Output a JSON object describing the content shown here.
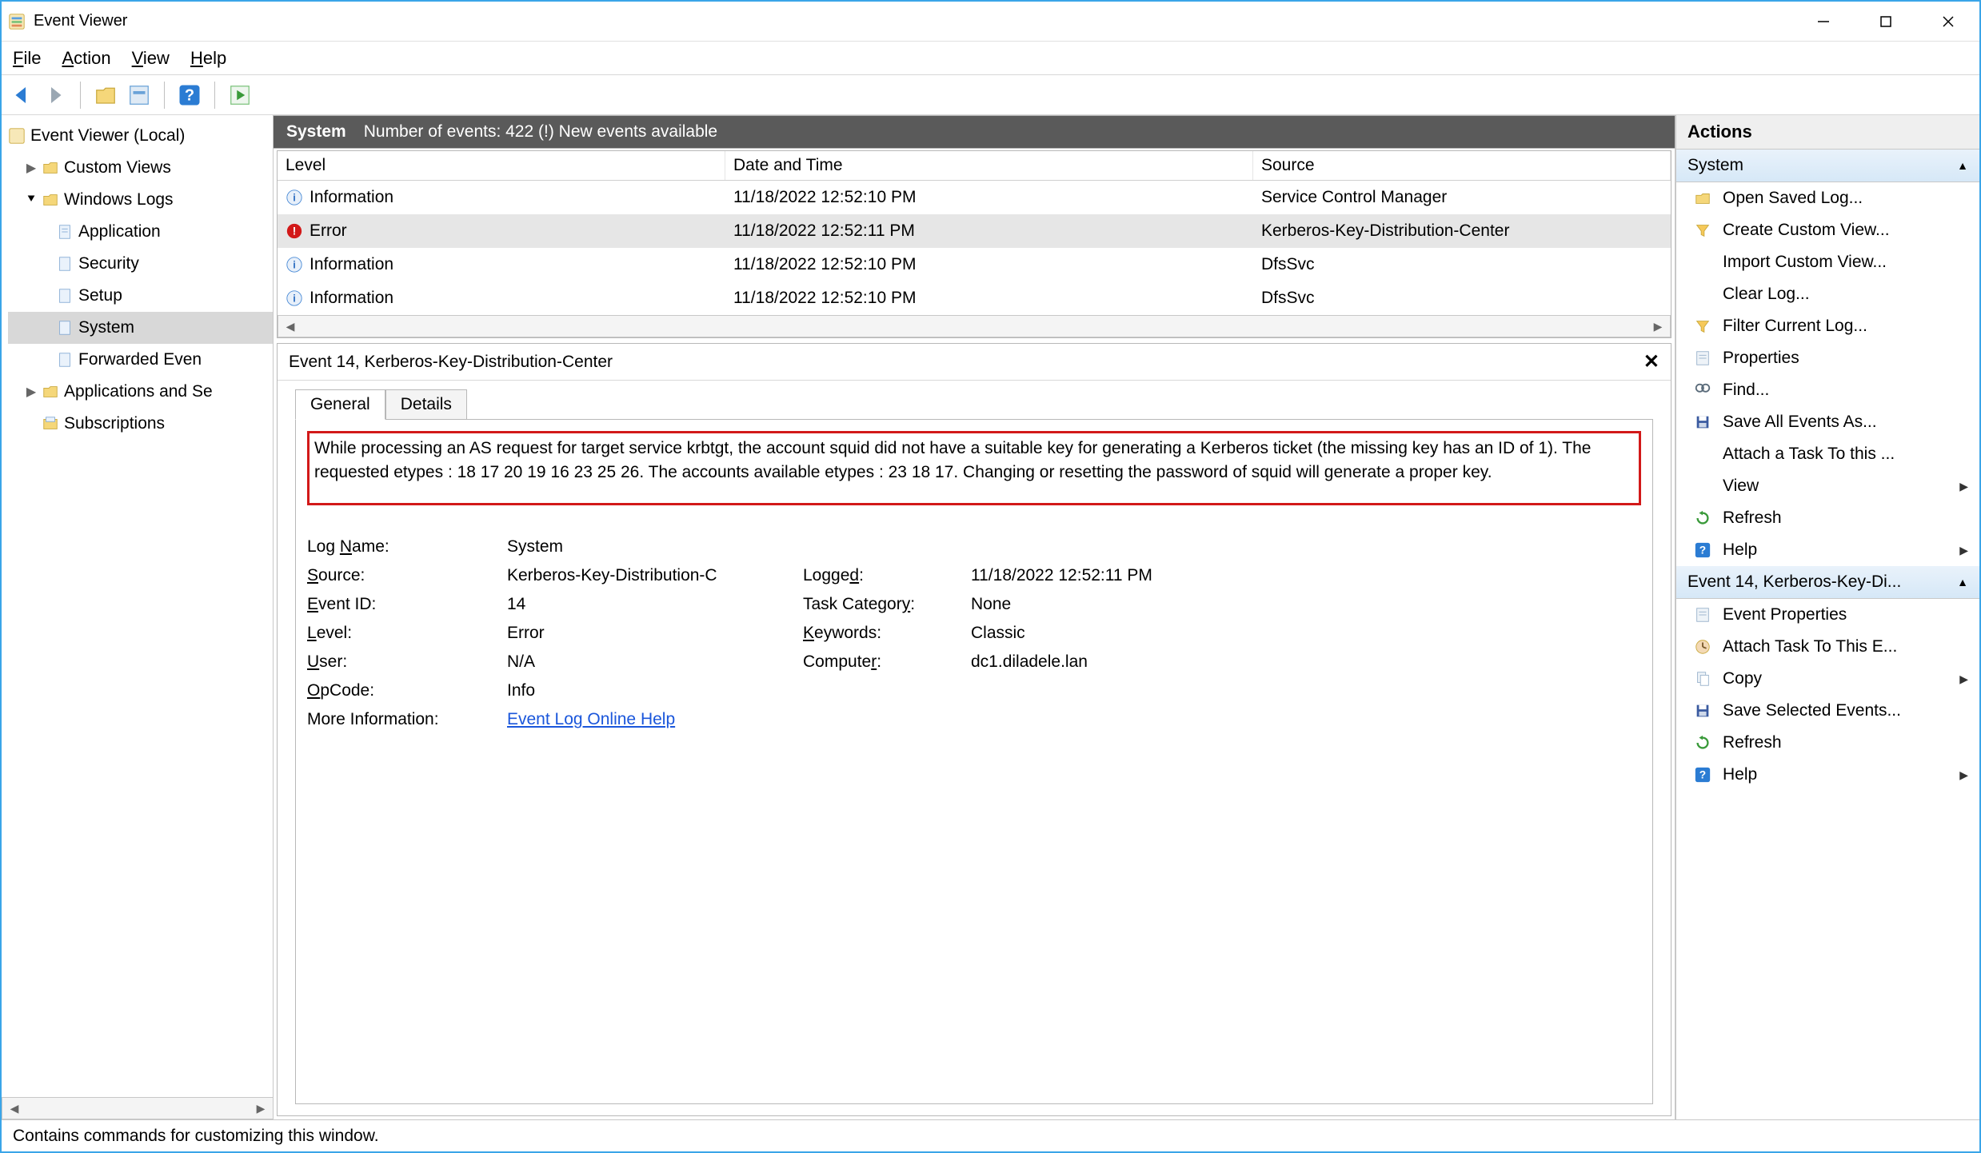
{
  "window": {
    "title": "Event Viewer"
  },
  "menu": {
    "file": "File",
    "action": "Action",
    "view": "View",
    "help": "Help"
  },
  "tree": {
    "root": "Event Viewer (Local)",
    "custom_views": "Custom Views",
    "windows_logs": "Windows Logs",
    "logs": {
      "application": "Application",
      "security": "Security",
      "setup": "Setup",
      "system": "System",
      "forwarded": "Forwarded Even"
    },
    "apps_services": "Applications and Se",
    "subscriptions": "Subscriptions"
  },
  "center": {
    "scope_name": "System",
    "scope_sub": "Number of events: 422 (!) New events available",
    "cols": {
      "level": "Level",
      "dt": "Date and Time",
      "source": "Source"
    },
    "rows": [
      {
        "level": "Information",
        "icon": "info",
        "dt": "11/18/2022 12:52:10 PM",
        "source": "Service Control Manager"
      },
      {
        "level": "Error",
        "icon": "error",
        "dt": "11/18/2022 12:52:11 PM",
        "source": "Kerberos-Key-Distribution-Center",
        "selected": true
      },
      {
        "level": "Information",
        "icon": "info",
        "dt": "11/18/2022 12:52:10 PM",
        "source": "DfsSvc"
      },
      {
        "level": "Information",
        "icon": "info",
        "dt": "11/18/2022 12:52:10 PM",
        "source": "DfsSvc"
      }
    ]
  },
  "detail": {
    "title": "Event 14, Kerberos-Key-Distribution-Center",
    "tabs": {
      "general": "General",
      "details": "Details"
    },
    "message": "While processing an AS request for target service krbtgt, the account squid did not have a suitable key for generating a Kerberos ticket (the missing key has an ID of 1). The requested etypes : 18  17  20  19  16  23  25  26. The accounts available etypes : 23  18  17. Changing or resetting the password of squid will generate a proper key.",
    "props": {
      "log_name_label": "Log Name:",
      "log_name": "System",
      "source_label": "Source:",
      "source": "Kerberos-Key-Distribution-C",
      "logged_label": "Logged:",
      "logged": "11/18/2022 12:52:11 PM",
      "event_id_label": "Event ID:",
      "event_id": "14",
      "task_cat_label": "Task Category:",
      "task_cat": "None",
      "level_label": "Level:",
      "level": "Error",
      "keywords_label": "Keywords:",
      "keywords": "Classic",
      "user_label": "User:",
      "user": "N/A",
      "computer_label": "Computer:",
      "computer": "dc1.diladele.lan",
      "opcode_label": "OpCode:",
      "opcode": "Info",
      "more_info_label": "More Information:",
      "more_info_link": "Event Log Online Help"
    }
  },
  "actions": {
    "header": "Actions",
    "group1": {
      "title": "System",
      "items": [
        {
          "id": "open-saved-log",
          "label": "Open Saved Log...",
          "icon": "folder"
        },
        {
          "id": "create-custom-view",
          "label": "Create Custom View...",
          "icon": "funnel"
        },
        {
          "id": "import-custom-view",
          "label": "Import Custom View...",
          "icon": "blank"
        },
        {
          "id": "clear-log",
          "label": "Clear Log...",
          "icon": "blank"
        },
        {
          "id": "filter-current-log",
          "label": "Filter Current Log...",
          "icon": "funnel"
        },
        {
          "id": "properties",
          "label": "Properties",
          "icon": "props"
        },
        {
          "id": "find",
          "label": "Find...",
          "icon": "find"
        },
        {
          "id": "save-all-events",
          "label": "Save All Events As...",
          "icon": "save"
        },
        {
          "id": "attach-task-log",
          "label": "Attach a Task To this ...",
          "icon": "blank"
        },
        {
          "id": "view",
          "label": "View",
          "icon": "blank",
          "arrow": true
        },
        {
          "id": "refresh1",
          "label": "Refresh",
          "icon": "refresh"
        },
        {
          "id": "help1",
          "label": "Help",
          "icon": "help",
          "arrow": true
        }
      ]
    },
    "group2": {
      "title": "Event 14, Kerberos-Key-Di...",
      "items": [
        {
          "id": "event-properties",
          "label": "Event Properties",
          "icon": "props"
        },
        {
          "id": "attach-task-event",
          "label": "Attach Task To This E...",
          "icon": "task"
        },
        {
          "id": "copy",
          "label": "Copy",
          "icon": "copy",
          "arrow": true
        },
        {
          "id": "save-selected",
          "label": "Save Selected Events...",
          "icon": "save"
        },
        {
          "id": "refresh2",
          "label": "Refresh",
          "icon": "refresh"
        },
        {
          "id": "help2",
          "label": "Help",
          "icon": "help",
          "arrow": true
        }
      ]
    }
  },
  "status": "Contains commands for customizing this window."
}
